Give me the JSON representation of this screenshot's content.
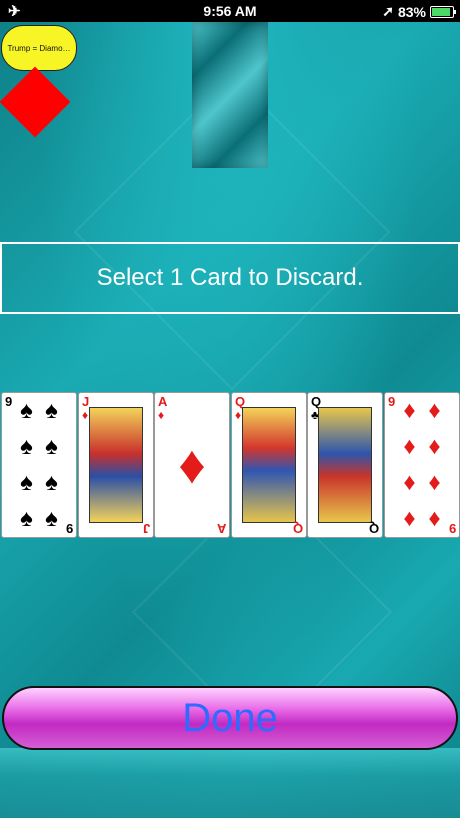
{
  "status_bar": {
    "time": "9:56 AM",
    "battery": "83%",
    "airplane_icon": "airplane-icon",
    "location_icon": "location-arrow-icon"
  },
  "trump": {
    "label": "Trump = Diamo…",
    "suit": "Diamonds",
    "color": "#ff0000"
  },
  "banner": {
    "text": "Select 1 Card to Discard."
  },
  "hand": [
    {
      "rank": "9",
      "suit": "spades",
      "symbol": "♠",
      "color": "black"
    },
    {
      "rank": "J",
      "suit": "diamonds",
      "symbol": "♦",
      "color": "red"
    },
    {
      "rank": "A",
      "suit": "diamonds",
      "symbol": "♦",
      "color": "red"
    },
    {
      "rank": "Q",
      "suit": "diamonds",
      "symbol": "♦",
      "color": "red"
    },
    {
      "rank": "Q",
      "suit": "clubs",
      "symbol": "♣",
      "color": "black"
    },
    {
      "rank": "9",
      "suit": "diamonds",
      "symbol": "♦",
      "color": "red"
    }
  ],
  "done_button": {
    "label": "Done"
  },
  "colors": {
    "background": "#1aa3ab",
    "trump_badge": "#f7f526",
    "done_text": "#2e6bff",
    "done_fill": "#c22ac2"
  }
}
